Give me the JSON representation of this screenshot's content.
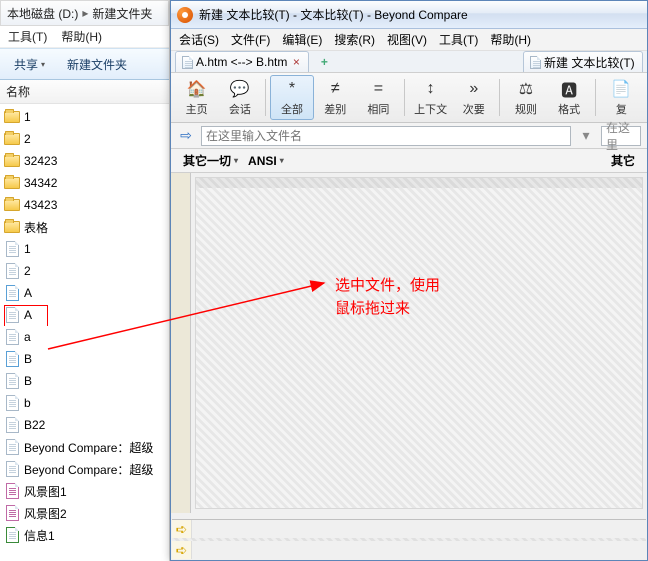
{
  "explorer": {
    "breadcrumb": {
      "drive": "本地磁盘 (D:)",
      "folder": "新建文件夹"
    },
    "menu": {
      "tools": "工具(T)",
      "help": "帮助(H)"
    },
    "band": {
      "share": "共享",
      "new_folder": "新建文件夹"
    },
    "column": {
      "name": "名称"
    },
    "files": [
      {
        "name": "1",
        "type": "folder"
      },
      {
        "name": "2",
        "type": "folder"
      },
      {
        "name": "32423",
        "type": "folder"
      },
      {
        "name": "34342",
        "type": "folder"
      },
      {
        "name": "43423",
        "type": "folder"
      },
      {
        "name": "表格",
        "type": "folder"
      },
      {
        "name": "1",
        "type": "page"
      },
      {
        "name": "2",
        "type": "page"
      },
      {
        "name": "A",
        "type": "html"
      },
      {
        "name": "A",
        "type": "page",
        "selected": true
      },
      {
        "name": "a",
        "type": "page"
      },
      {
        "name": "B",
        "type": "html"
      },
      {
        "name": "B",
        "type": "page"
      },
      {
        "name": "b",
        "type": "page"
      },
      {
        "name": "B22",
        "type": "page"
      },
      {
        "name": "Beyond Compare：超级",
        "type": "page"
      },
      {
        "name": "Beyond Compare：超级",
        "type": "page"
      },
      {
        "name": "风景图1",
        "type": "phg"
      },
      {
        "name": "风景图2",
        "type": "phg"
      },
      {
        "name": "信息1",
        "type": "xls"
      }
    ]
  },
  "bc": {
    "title": "新建 文本比较(T) - 文本比较(T) - Beyond Compare",
    "menu": [
      "会话(S)",
      "文件(F)",
      "编辑(E)",
      "搜索(R)",
      "视图(V)",
      "工具(T)",
      "帮助(H)"
    ],
    "tabs": {
      "left": "A.htm <--> B.htm",
      "right": "新建 文本比较(T)"
    },
    "toolbar": [
      {
        "id": "home",
        "label": "主页"
      },
      {
        "id": "session",
        "label": "会话"
      },
      {
        "id": "all",
        "label": "全部",
        "active": true
      },
      {
        "id": "diff",
        "label": "差别"
      },
      {
        "id": "same",
        "label": "相同"
      },
      {
        "id": "context",
        "label": "上下文"
      },
      {
        "id": "minor",
        "label": "次要"
      },
      {
        "id": "rules",
        "label": "规则"
      },
      {
        "id": "format",
        "label": "格式"
      },
      {
        "id": "copy",
        "label": "复"
      }
    ],
    "filter_placeholder": "在这里输入文件名",
    "filter_right_stub": "在这里",
    "filter2": {
      "other": "其它一切",
      "encoding": "ANSI",
      "right_stub": "其它"
    },
    "annotation": {
      "line1": "选中文件，使用",
      "line2": "鼠标拖过来"
    }
  }
}
